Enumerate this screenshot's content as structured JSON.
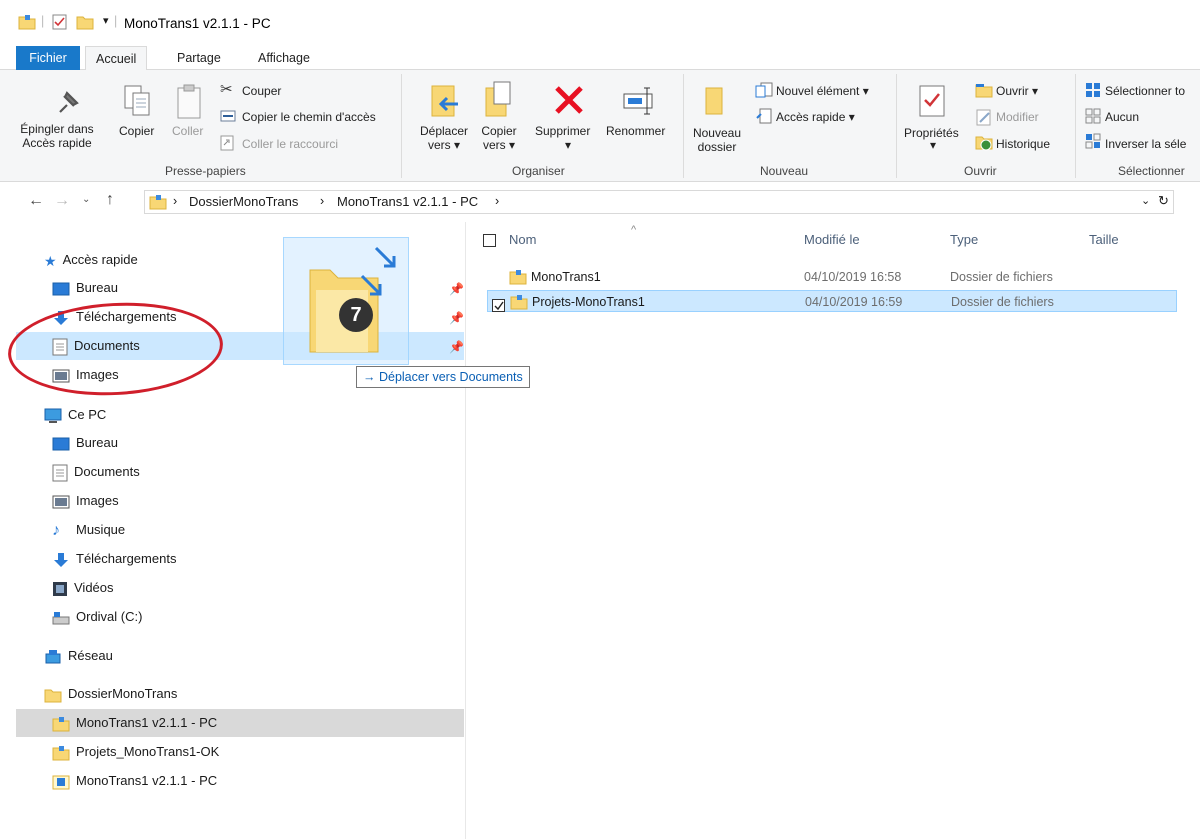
{
  "window": {
    "title": "MonoTrans1 v2.1.1 - PC"
  },
  "tabs": {
    "fichier": "Fichier",
    "accueil": "Accueil",
    "partage": "Partage",
    "affichage": "Affichage"
  },
  "ribbon": {
    "pin": "Épingler dans\nAccès rapide",
    "pin_l1": "Épingler dans",
    "pin_l2": "Accès rapide",
    "copy": "Copier",
    "paste": "Coller",
    "cut": "Couper",
    "copy_path": "Copier le chemin d'accès",
    "paste_shortcut": "Coller le raccourci",
    "group_clipboard": "Presse-papiers",
    "move_l1": "Déplacer",
    "move_l2": "vers ▾",
    "copyto_l1": "Copier",
    "copyto_l2": "vers ▾",
    "delete": "Supprimer",
    "delete_arrow": "▾",
    "rename": "Renommer",
    "group_organize": "Organiser",
    "new_folder_l1": "Nouveau",
    "new_folder_l2": "dossier",
    "new_item": "Nouvel élément ▾",
    "quick_access": "Accès rapide ▾",
    "group_new": "Nouveau",
    "properties": "Propriétés",
    "properties_arrow": "▾",
    "open": "Ouvrir ▾",
    "modify": "Modifier",
    "history": "Historique",
    "group_open": "Ouvrir",
    "select_all": "Sélectionner to",
    "select_none": "Aucun",
    "invert_selection": "Inverser la séle",
    "group_select": "Sélectionner"
  },
  "address": {
    "crumb1": "DossierMonoTrans",
    "crumb2": "MonoTrans1 v2.1.1 - PC",
    "sep": "›"
  },
  "nav": {
    "quick_access": "Accès rapide",
    "qa_items": [
      "Bureau",
      "Téléchargements",
      "Documents",
      "Images"
    ],
    "this_pc": "Ce PC",
    "pc_items": [
      "Bureau",
      "Documents",
      "Images",
      "Musique",
      "Téléchargements",
      "Vidéos",
      "Ordival (C:)"
    ],
    "network": "Réseau",
    "dossier": "DossierMonoTrans",
    "dossier_items": [
      "MonoTrans1 v2.1.1 - PC",
      "Projets_MonoTrans1-OK",
      "MonoTrans1 v2.1.1 - PC"
    ]
  },
  "tooltip": "→ Déplacer vers Documents",
  "drag_badge": "7",
  "columns": {
    "name": "Nom",
    "modified": "Modifié le",
    "type": "Type",
    "size": "Taille"
  },
  "files": [
    {
      "name": "MonoTrans1",
      "modified": "04/10/2019 16:58",
      "type": "Dossier de fichiers"
    },
    {
      "name": "Projets-MonoTrans1",
      "modified": "04/10/2019 16:59",
      "type": "Dossier de fichiers"
    }
  ],
  "colors": {
    "accent": "#1979ca",
    "selection": "#cce8ff",
    "annotation": "#d01f2b"
  }
}
